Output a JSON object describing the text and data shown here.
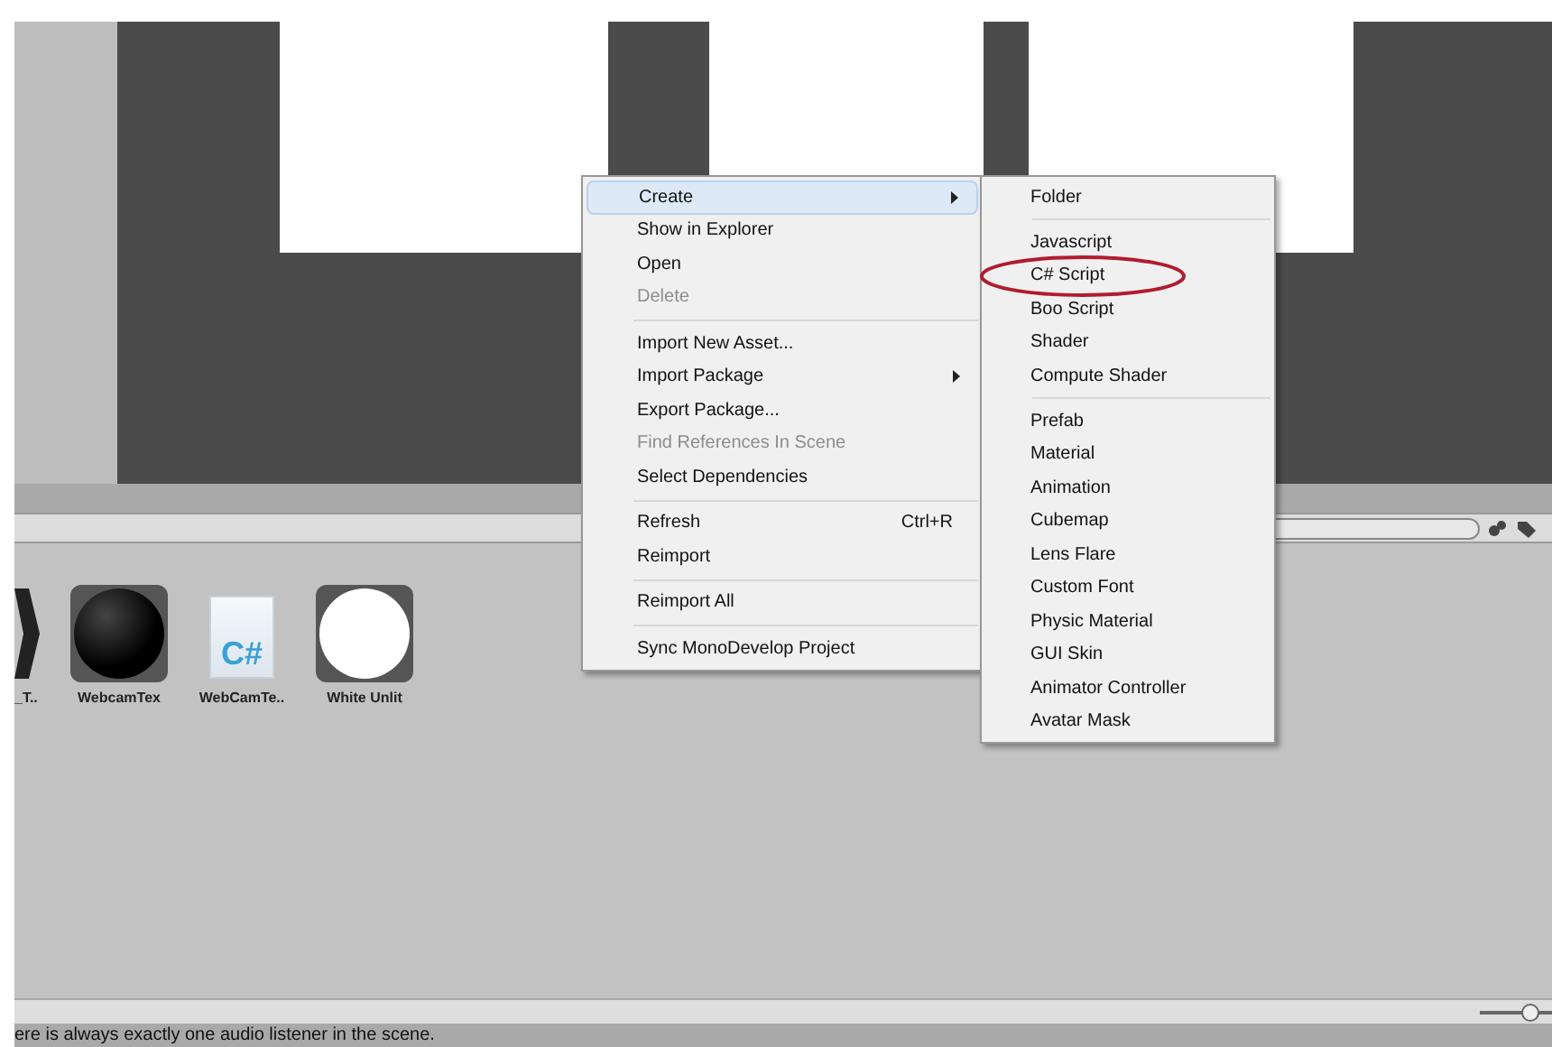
{
  "context_menu": {
    "items": [
      {
        "kind": "item",
        "label": "Create",
        "highlighted": true,
        "disabled": false,
        "submenu": true
      },
      {
        "kind": "item",
        "label": "Show in Explorer",
        "highlighted": false,
        "disabled": false,
        "submenu": false
      },
      {
        "kind": "item",
        "label": "Open",
        "highlighted": false,
        "disabled": false,
        "submenu": false
      },
      {
        "kind": "item",
        "label": "Delete",
        "highlighted": false,
        "disabled": true,
        "submenu": false
      },
      {
        "kind": "separator"
      },
      {
        "kind": "item",
        "label": "Import New Asset...",
        "highlighted": false,
        "disabled": false,
        "submenu": false
      },
      {
        "kind": "item",
        "label": "Import Package",
        "highlighted": false,
        "disabled": false,
        "submenu": true
      },
      {
        "kind": "item",
        "label": "Export Package...",
        "highlighted": false,
        "disabled": false,
        "submenu": false
      },
      {
        "kind": "item",
        "label": "Find References In Scene",
        "highlighted": false,
        "disabled": true,
        "submenu": false
      },
      {
        "kind": "item",
        "label": "Select Dependencies",
        "highlighted": false,
        "disabled": false,
        "submenu": false
      },
      {
        "kind": "separator"
      },
      {
        "kind": "item",
        "label": "Refresh",
        "shortcut": "Ctrl+R",
        "highlighted": false,
        "disabled": false,
        "submenu": false
      },
      {
        "kind": "item",
        "label": "Reimport",
        "highlighted": false,
        "disabled": false,
        "submenu": false
      },
      {
        "kind": "separator"
      },
      {
        "kind": "item",
        "label": "Reimport All",
        "highlighted": false,
        "disabled": false,
        "submenu": false
      },
      {
        "kind": "separator"
      },
      {
        "kind": "item",
        "label": "Sync MonoDevelop Project",
        "highlighted": false,
        "disabled": false,
        "submenu": false
      }
    ]
  },
  "create_submenu": {
    "items": [
      {
        "kind": "item",
        "label": "Folder",
        "circled": false
      },
      {
        "kind": "separator"
      },
      {
        "kind": "item",
        "label": "Javascript",
        "circled": false
      },
      {
        "kind": "item",
        "label": "C# Script",
        "circled": true
      },
      {
        "kind": "item",
        "label": "Boo Script",
        "circled": false
      },
      {
        "kind": "item",
        "label": "Shader",
        "circled": false
      },
      {
        "kind": "item",
        "label": "Compute Shader",
        "circled": false
      },
      {
        "kind": "separator"
      },
      {
        "kind": "item",
        "label": "Prefab",
        "circled": false
      },
      {
        "kind": "item",
        "label": "Material",
        "circled": false
      },
      {
        "kind": "item",
        "label": "Animation",
        "circled": false
      },
      {
        "kind": "item",
        "label": "Cubemap",
        "circled": false
      },
      {
        "kind": "item",
        "label": "Lens Flare",
        "circled": false
      },
      {
        "kind": "item",
        "label": "Custom Font",
        "circled": false
      },
      {
        "kind": "item",
        "label": "Physic Material",
        "circled": false
      },
      {
        "kind": "item",
        "label": "GUI Skin",
        "circled": false
      },
      {
        "kind": "item",
        "label": "Animator Controller",
        "circled": false
      },
      {
        "kind": "item",
        "label": "Avatar Mask",
        "circled": false
      }
    ]
  },
  "assets": [
    {
      "kind": "shape",
      "name": "_T.."
    },
    {
      "kind": "dark_sphere",
      "name": "WebcamTex"
    },
    {
      "kind": "script",
      "name": "WebCamTe..",
      "glyph": "C#"
    },
    {
      "kind": "white_sphere",
      "name": "White Unlit"
    }
  ],
  "zoom_slider": {
    "level": 0.7
  },
  "status_bar": {
    "message": "ere is always exactly one audio listener in the scene."
  }
}
